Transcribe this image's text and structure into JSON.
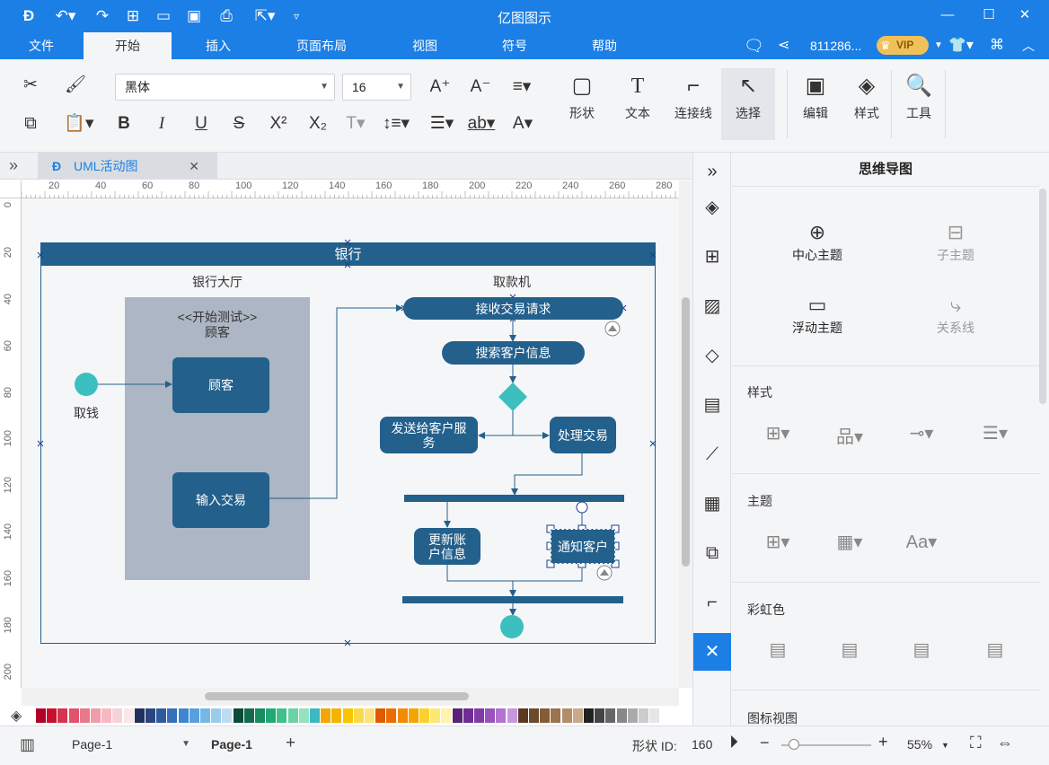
{
  "app": {
    "title": "亿图图示"
  },
  "menu": {
    "tabs": [
      "文件",
      "开始",
      "插入",
      "页面布局",
      "视图",
      "符号",
      "帮助"
    ],
    "active": "开始",
    "user_id": "811286...",
    "vip": "VIP"
  },
  "ribbon": {
    "font_family": "黑体",
    "font_size": "16",
    "shape_label": "形状",
    "text_label": "文本",
    "connector_label": "连接线",
    "select_label": "选择",
    "edit_label": "编辑",
    "style_label": "样式",
    "tools_label": "工具"
  },
  "document": {
    "tab_name": "UML活动图"
  },
  "ruler": {
    "h_ticks": [
      "20",
      "40",
      "60",
      "80",
      "100",
      "120",
      "140",
      "160",
      "180",
      "200",
      "220",
      "240",
      "260",
      "280"
    ],
    "v_ticks": [
      "0",
      "20",
      "40",
      "60",
      "80",
      "100",
      "120",
      "140",
      "160",
      "180",
      "200"
    ]
  },
  "diagram": {
    "pool_title": "银行",
    "lane1_title": "银行大厅",
    "lane2_title": "取款机",
    "actor_stereotype": "<<开始测试>>",
    "actor_name": "顾客",
    "start_label": "取钱",
    "node_customer": "顾客",
    "node_input": "输入交易",
    "node_receive": "接收交易请求",
    "node_search": "搜索客户信息",
    "node_send": "发送给客户服务",
    "node_process": "处理交易",
    "node_update": "更新账户信息",
    "node_notify": "通知客户"
  },
  "panel": {
    "title": "思维导图",
    "center_topic": "中心主题",
    "sub_topic": "子主题",
    "float_topic": "浮动主题",
    "relation_line": "关系线",
    "section_style": "样式",
    "section_theme": "主题",
    "section_rainbow": "彩虹色",
    "section_icon_view": "图标视图"
  },
  "status": {
    "page_selector": "Page-1",
    "page_tab": "Page-1",
    "shape_id_label": "形状 ID:",
    "shape_id": "160",
    "zoom": "55%"
  },
  "colors": {
    "accent": "#1b7fe6",
    "node": "#23608c",
    "teal": "#3dbfc0",
    "lane": "#acb6c4"
  }
}
